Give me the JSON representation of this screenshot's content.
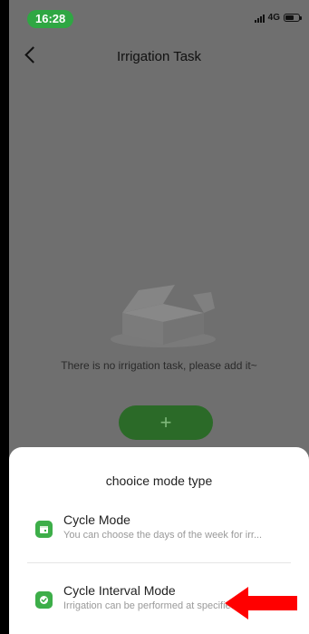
{
  "status_bar": {
    "time": "16:28",
    "network": "4G"
  },
  "nav": {
    "title": "Irrigation Task"
  },
  "empty_state": {
    "message": "There is no irrigation task, please add it~",
    "add_label": "+"
  },
  "sheet": {
    "title": "chooice mode type",
    "modes": [
      {
        "name": "Cycle Mode",
        "description": "You can choose the days of the week for irr...",
        "icon": "calendar-icon"
      },
      {
        "name": "Cycle Interval Mode",
        "description": "Irrigation can be performed at specified int...",
        "icon": "check-circle-icon"
      }
    ]
  },
  "colors": {
    "accent": "#3dae49",
    "status_pill": "#2fa743",
    "annotation_arrow": "#ff0000"
  }
}
